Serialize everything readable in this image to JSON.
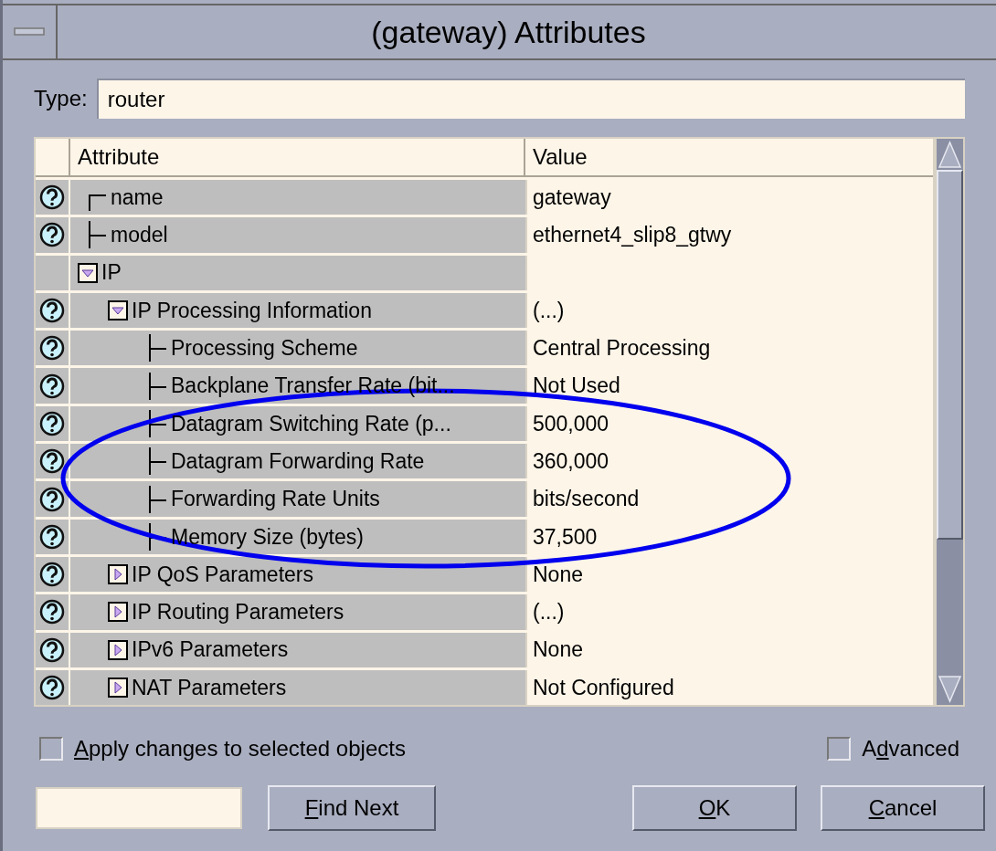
{
  "window": {
    "title": "(gateway) Attributes"
  },
  "type_field": {
    "label": "Type:",
    "value": "router"
  },
  "table": {
    "columns": [
      "Attribute",
      "Value"
    ],
    "rows": [
      {
        "attribute": "name",
        "value": "gateway",
        "help": true
      },
      {
        "attribute": "model",
        "value": "ethernet4_slip8_gtwy",
        "help": true
      },
      {
        "attribute": "IP",
        "help": false,
        "expanded": true,
        "children": [
          {
            "attribute": "IP Processing Information",
            "value": "(...)",
            "help": true,
            "expanded": true,
            "children": [
              {
                "attribute": "Processing Scheme",
                "value": "Central Processing",
                "help": true
              },
              {
                "attribute": "Backplane Transfer Rate (bit...",
                "value": "Not Used",
                "help": true
              },
              {
                "attribute": "Datagram Switching Rate (p...",
                "value": "500,000",
                "help": true
              },
              {
                "attribute": "Datagram Forwarding Rate",
                "value": "360,000",
                "help": true
              },
              {
                "attribute": "Forwarding Rate Units",
                "value": "bits/second",
                "help": true
              },
              {
                "attribute": "Memory Size (bytes)",
                "value": "37,500",
                "help": true
              }
            ]
          },
          {
            "attribute": "IP QoS Parameters",
            "value": "None",
            "help": true,
            "expanded": false
          },
          {
            "attribute": "IP Routing Parameters",
            "value": "(...)",
            "help": true,
            "expanded": false
          },
          {
            "attribute": "IPv6 Parameters",
            "value": "None",
            "help": true,
            "expanded": false
          },
          {
            "attribute": "NAT Parameters",
            "value": "Not Configured",
            "help": true,
            "expanded": false
          }
        ]
      }
    ]
  },
  "apply_checkbox": {
    "label_parts": [
      {
        "text": "A",
        "underline": true
      },
      {
        "text": "pply changes to selected objects",
        "underline": false
      }
    ],
    "checked": false
  },
  "advanced_checkbox": {
    "label_parts": [
      {
        "text": "A",
        "underline": false
      },
      {
        "text": "d",
        "underline": true
      },
      {
        "text": "vanced",
        "underline": false
      }
    ],
    "checked": false
  },
  "find_button": {
    "label_parts": [
      {
        "text": "F",
        "underline": true
      },
      {
        "text": "ind Next",
        "underline": false
      }
    ]
  },
  "buttons": [
    {
      "label_parts": [
        {
          "text": "O",
          "underline": true
        },
        {
          "text": "K",
          "underline": false
        }
      ]
    },
    {
      "label_parts": [
        {
          "text": "C",
          "underline": true
        },
        {
          "text": "ancel",
          "underline": false
        }
      ]
    }
  ]
}
